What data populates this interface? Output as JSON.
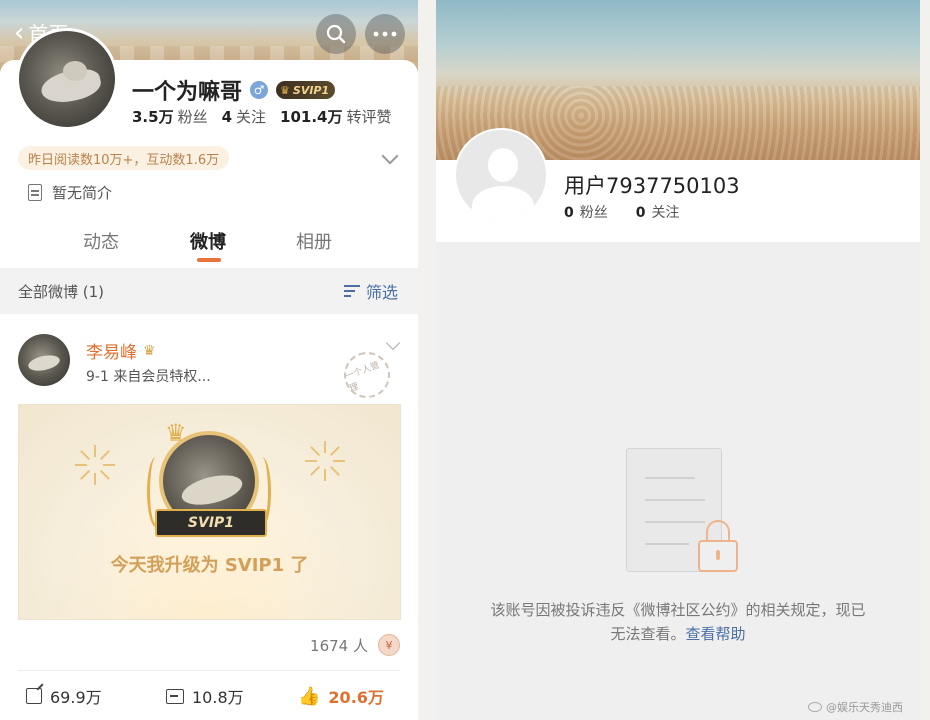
{
  "left": {
    "nav": {
      "back_label": "首页"
    },
    "profile": {
      "name": "一个为嘛哥",
      "gender_symbol": "♂",
      "svip_label": "SVIP1",
      "stats": [
        {
          "value": "3.5万",
          "label": "粉丝"
        },
        {
          "value": "4",
          "label": "关注"
        },
        {
          "value": "101.4万",
          "label": "转评赞"
        }
      ],
      "read_stats": "昨日阅读数10万+，互动数1.6万",
      "bio": "暂无简介"
    },
    "tabs": [
      "动态",
      "微博",
      "相册"
    ],
    "active_tab": "微博",
    "filter": {
      "all_label": "全部微博 (1)",
      "filter_label": "筛选"
    },
    "post": {
      "author": "李易峰",
      "meta": "9-1  来自会员特权...",
      "stamp_text": "一个人管理",
      "image_badge": "SVIP1",
      "image_caption": "今天我升级为 SVIP1 了",
      "likers": "1674 人",
      "reward_symbol": "¥",
      "actions": {
        "share": "69.9万",
        "comment": "10.8万",
        "like": "20.6万"
      }
    }
  },
  "right": {
    "user_name": "用户7937750103",
    "stats": [
      {
        "value": "0",
        "label": "粉丝"
      },
      {
        "value": "0",
        "label": "关注"
      }
    ],
    "notice_text": "该账号因被投诉违反《微博社区公约》的相关规定，现已无法查看。",
    "help_link": "查看帮助"
  },
  "watermark": "@娱乐天秀迪西"
}
